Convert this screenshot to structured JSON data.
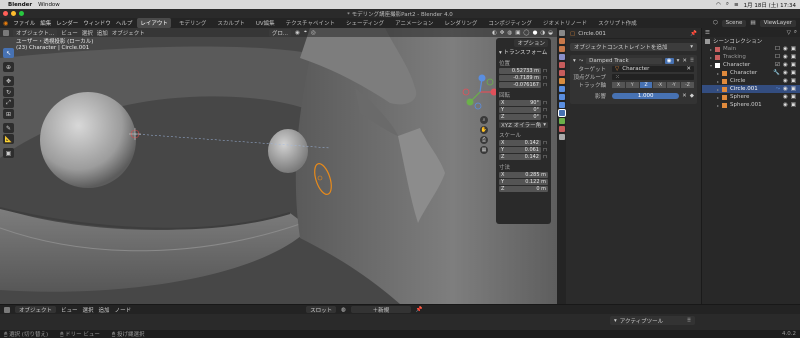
{
  "mac_menubar": {
    "app": "Blender",
    "menus": [
      "Window"
    ],
    "clock": "1月 18日 (土) 17:34"
  },
  "window": {
    "title": "* モデリング講座撮影Part2 - Blender 4.0"
  },
  "top_menu": {
    "menus": [
      "ファイル",
      "編集",
      "レンダー",
      "ウィンドウ",
      "ヘルプ"
    ],
    "workspaces": [
      "レイアウト",
      "モデリング",
      "スカルプト",
      "UV編集",
      "テクスチャペイント",
      "シェーディング",
      "アニメーション",
      "レンダリング",
      "コンポジティング",
      "ジオメトリノード",
      "スクリプト作成"
    ],
    "active_workspace": "レイアウト",
    "scene": "Scene",
    "view_layer": "ViewLayer"
  },
  "viewport": {
    "mode": "オブジェクト...",
    "menus": [
      "ビュー",
      "選択",
      "追加",
      "オブジェクト"
    ],
    "orientation": "グロ...",
    "options_label": "オプション",
    "info_line1": "ユーザー・透視投影 (ローカル)",
    "info_line2": "(23) Character | Circle.001",
    "tools": [
      "select",
      "cursor",
      "move",
      "rotate",
      "scale",
      "transform",
      "annotate",
      "measure",
      "add-cube"
    ]
  },
  "npanel": {
    "section": "トランスフォーム",
    "location_label": "位置",
    "location": [
      "0.52733 m",
      "-0.7189 m",
      "-0.076167"
    ],
    "rotation_label": "回転",
    "rotation": [
      [
        "X",
        "90°"
      ],
      [
        "Y",
        "0°"
      ],
      [
        "Z",
        "0°"
      ]
    ],
    "rotation_mode": "XYZ オイラー角",
    "scale_label": "スケール",
    "scale": [
      [
        "X",
        "0.142"
      ],
      [
        "Y",
        "0.061"
      ],
      [
        "Z",
        "0.142"
      ]
    ],
    "dimensions_label": "寸法",
    "dimensions": [
      [
        "X",
        "0.285 m"
      ],
      [
        "Y",
        "0.122 m"
      ],
      [
        "Z",
        "0 m"
      ]
    ]
  },
  "properties": {
    "object_name": "Circle.001",
    "add_constraint": "オブジェクトコンストレイントを追加",
    "constraint_name": "Damped Track",
    "target_label": "ターゲット",
    "target_value": "Character",
    "vertex_group_label": "頂点グループ",
    "track_axis_label": "トラック軸",
    "axes": [
      "X",
      "Y",
      "Z",
      "-X",
      "-Y",
      "-Z"
    ],
    "active_axis": "Z",
    "influence_label": "影響",
    "influence_value": "1.000"
  },
  "outliner": {
    "root": "シーンコレクション",
    "items": [
      {
        "name": "Main",
        "indent": 1,
        "selected": false,
        "color": "#c86060"
      },
      {
        "name": "Tracking",
        "indent": 1,
        "selected": false,
        "color": "#c86060"
      },
      {
        "name": "Character",
        "indent": 1,
        "selected": false,
        "color": "#ffffff"
      },
      {
        "name": "Character",
        "indent": 2,
        "selected": false,
        "color": "#e08a3c"
      },
      {
        "name": "Circle",
        "indent": 2,
        "selected": false,
        "color": "#e08a3c"
      },
      {
        "name": "Circle.001",
        "indent": 2,
        "selected": true,
        "color": "#e08a3c"
      },
      {
        "name": "Sphere",
        "indent": 2,
        "selected": false,
        "color": "#e08a3c"
      },
      {
        "name": "Sphere.001",
        "indent": 2,
        "selected": false,
        "color": "#e08a3c"
      }
    ]
  },
  "timeline": {
    "mode": "オブジェクト",
    "menus": [
      "ビュー",
      "選択",
      "追加",
      "ノード"
    ],
    "slot_label": "スロット",
    "new_label": "新規",
    "active_tool": "アクティブツール"
  },
  "statusbar": {
    "items": [
      "選択 (切り替え)",
      "ドリー ビュー",
      "投げ縄選択"
    ],
    "version": "4.0.2"
  },
  "colors": {
    "accent": "#4772b3",
    "viewport_bg": "#4c4c4c",
    "selection_outline": "#e88a1a"
  }
}
